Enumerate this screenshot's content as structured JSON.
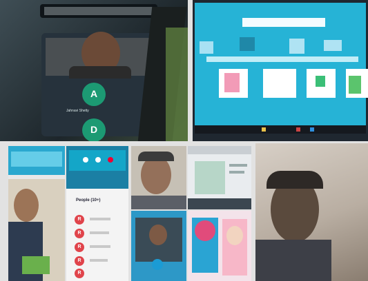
{
  "panels": {
    "call_phone": {
      "participant_name": "Jahnavi Shetty",
      "avatar_letters": [
        "A",
        "D"
      ],
      "border_color": "#0e1116",
      "screen_color": "#26323c"
    },
    "lesson_board": {
      "accent": "#26b3d6",
      "card_color": "#ffffff"
    },
    "people_panel": {
      "title": "People (10+)",
      "avatar_letters": [
        "R",
        "R",
        "R",
        "R",
        "R"
      ],
      "avatar_color": "#e0444b"
    },
    "webcam_large": {
      "wall_color": "#cfc6bd"
    },
    "thumb_quiz": {
      "accent": "#e14b7b"
    }
  }
}
